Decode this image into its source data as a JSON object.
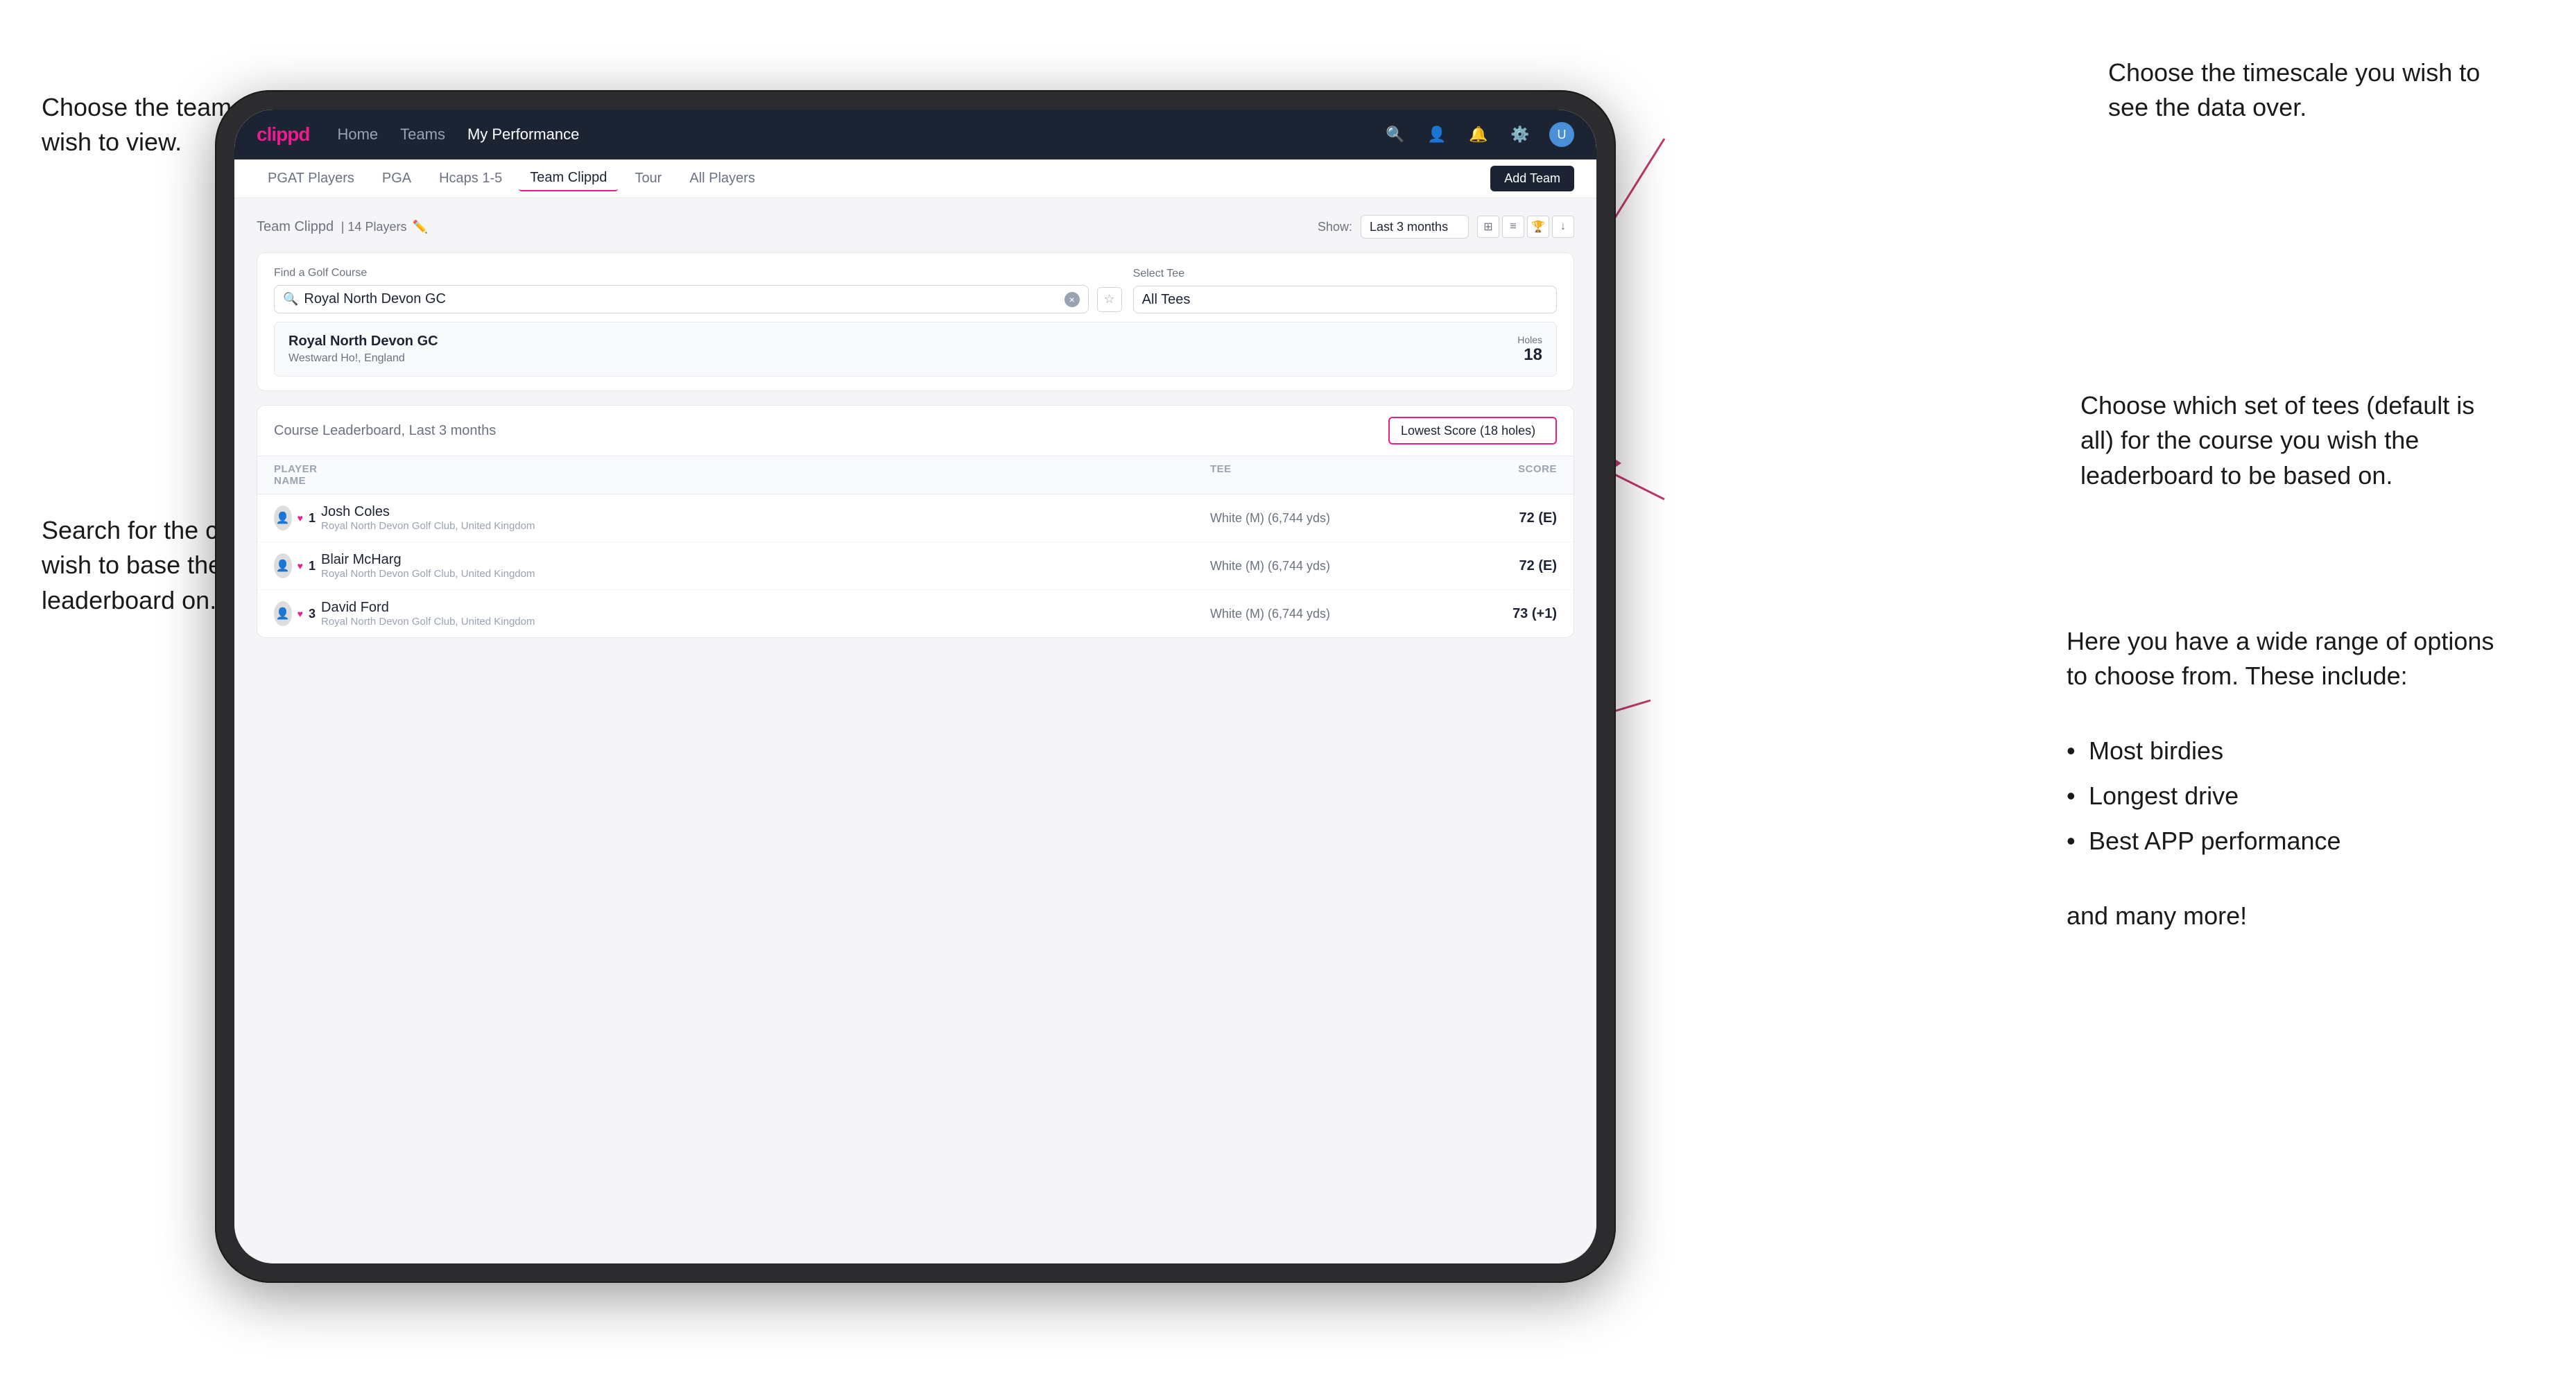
{
  "annotations": {
    "top_left_title": "Choose the team you\nwish to view.",
    "mid_left_title": "Search for the course\nyou wish to base the\nleaderboard on.",
    "top_right_title": "Choose the timescale you\nwish to see the data over.",
    "mid_right_title": "Choose which set of tees\n(default is all) for the course\nyou wish the leaderboard to\nbe based on.",
    "bottom_right_title": "Here you have a wide range\nof options to choose from.\nThese include:",
    "bullet_items": [
      "Most birdies",
      "Longest drive",
      "Best APP performance"
    ],
    "and_more": "and many more!"
  },
  "nav": {
    "logo": "clippd",
    "links": [
      "Home",
      "Teams",
      "My Performance"
    ],
    "active_link": "My Performance"
  },
  "sub_nav": {
    "tabs": [
      "PGAT Players",
      "PGA",
      "Hcaps 1-5",
      "Team Clippd",
      "Tour",
      "All Players"
    ],
    "active_tab": "Team Clippd",
    "add_team_label": "Add Team"
  },
  "team_header": {
    "title": "Team Clippd",
    "player_count": "14 Players",
    "show_label": "Show:",
    "show_value": "Last 3 months"
  },
  "search": {
    "find_label": "Find a Golf Course",
    "placeholder": "Royal North Devon GC",
    "select_tee_label": "Select Tee",
    "tee_value": "All Tees"
  },
  "course_result": {
    "name": "Royal North Devon GC",
    "location": "Westward Ho!, England",
    "holes_label": "Holes",
    "holes_value": "18"
  },
  "leaderboard": {
    "title": "Course Leaderboard,",
    "subtitle": "Last 3 months",
    "score_type": "Lowest Score (18 holes)",
    "columns": {
      "player_name": "PLAYER NAME",
      "tee": "TEE",
      "score": "SCORE"
    },
    "rows": [
      {
        "rank": "1",
        "name": "Josh Coles",
        "club": "Royal North Devon Golf Club, United Kingdom",
        "tee": "White (M) (6,744 yds)",
        "score": "72 (E)"
      },
      {
        "rank": "1",
        "name": "Blair McHarg",
        "club": "Royal North Devon Golf Club, United Kingdom",
        "tee": "White (M) (6,744 yds)",
        "score": "72 (E)"
      },
      {
        "rank": "3",
        "name": "David Ford",
        "club": "Royal North Devon Golf Club, United Kingdom",
        "tee": "White (M) (6,744 yds)",
        "score": "73 (+1)"
      }
    ]
  },
  "colors": {
    "brand_pink": "#e91e8c",
    "nav_dark": "#1c2333",
    "text_muted": "#6b7280"
  }
}
